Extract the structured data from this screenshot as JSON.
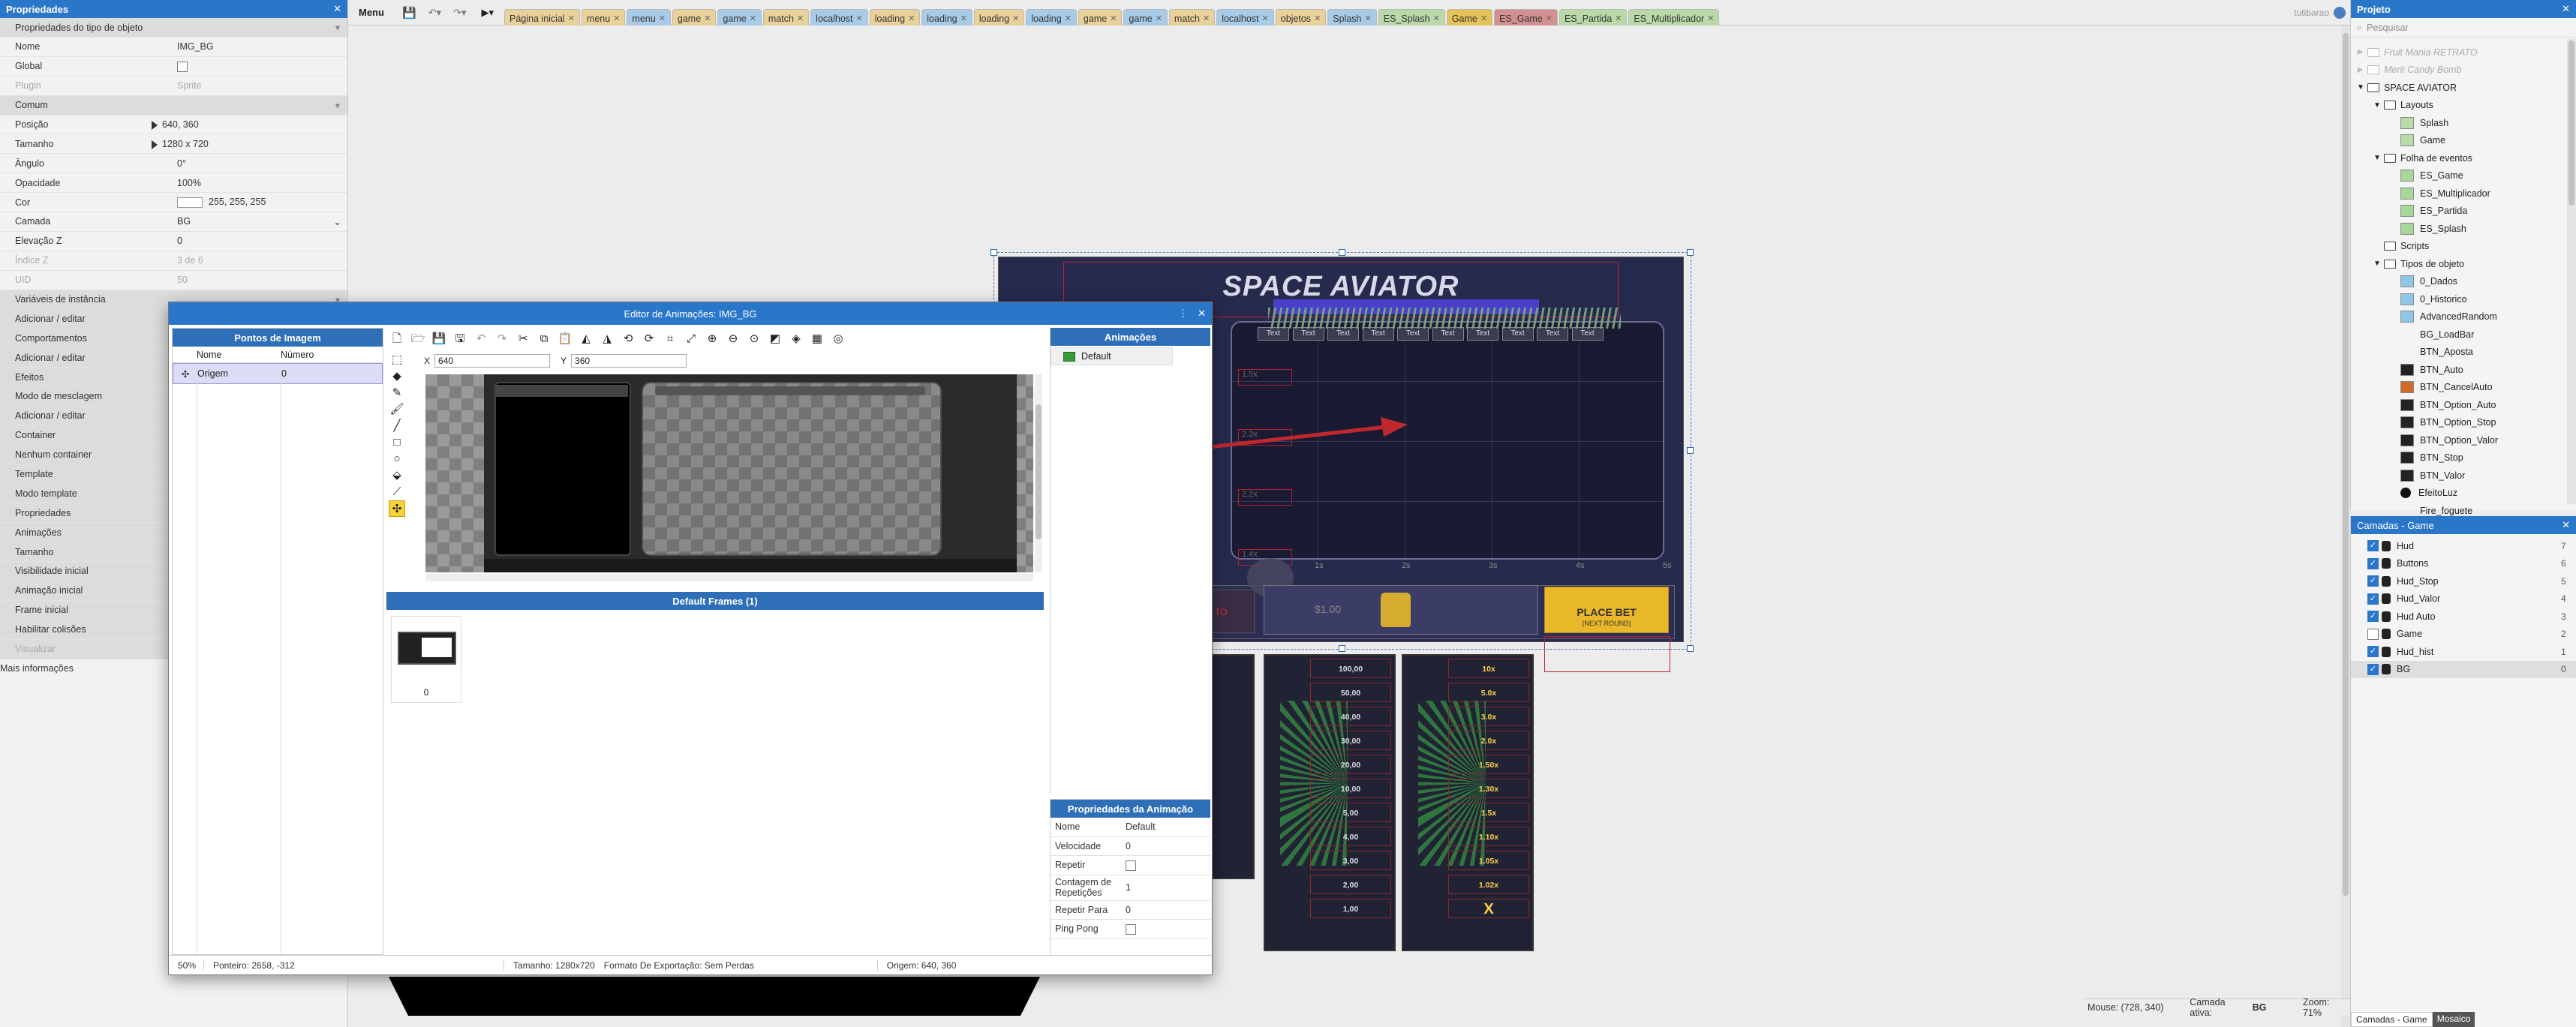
{
  "left_panel": {
    "header": "Propriedades",
    "section_type": "Propriedades do tipo de objeto",
    "rows": [
      {
        "k": "Nome",
        "v": "IMG_BG",
        "style": "row"
      },
      {
        "k": "Global",
        "v": "",
        "style": "check"
      },
      {
        "k": "Plugin",
        "v": "Sprite",
        "style": "dis"
      },
      {
        "k": "Comum",
        "v": "",
        "style": "sec"
      },
      {
        "k": "Posição",
        "v": "640, 360",
        "style": "tri"
      },
      {
        "k": "Tamanho",
        "v": "1280  x 720",
        "style": "tri"
      },
      {
        "k": "Ângulo",
        "v": "0°",
        "style": "row"
      },
      {
        "k": "Opacidade",
        "v": "100%",
        "style": "row"
      },
      {
        "k": "Cor",
        "v": "255, 255, 255",
        "style": "color"
      },
      {
        "k": "Camada",
        "v": "BG",
        "style": "select"
      },
      {
        "k": "Elevação Z",
        "v": "0",
        "style": "row"
      },
      {
        "k": "Índice Z",
        "v": "3 de 6",
        "style": "dis"
      },
      {
        "k": "UID",
        "v": "50",
        "style": "dis"
      },
      {
        "k": "Variáveis de instância",
        "v": "",
        "style": "sec"
      },
      {
        "k": "Adicionar / editar",
        "v": "",
        "style": "link"
      },
      {
        "k": "Comportamentos",
        "v": "",
        "style": "sec"
      },
      {
        "k": "Adicionar / editar",
        "v": "",
        "style": "link"
      },
      {
        "k": "Efeitos",
        "v": "",
        "style": "sec"
      },
      {
        "k": "Modo de mesclagem",
        "v": "",
        "style": "link"
      },
      {
        "k": "Adicionar / editar",
        "v": "",
        "style": "link"
      },
      {
        "k": "Container",
        "v": "",
        "style": "sec"
      },
      {
        "k": "Nenhum container",
        "v": "",
        "style": "link"
      },
      {
        "k": "Template",
        "v": "",
        "style": "sec"
      },
      {
        "k": "Modo template",
        "v": "",
        "style": "link"
      },
      {
        "k": "Propriedades",
        "v": "",
        "style": "sec"
      },
      {
        "k": "Animações",
        "v": "",
        "style": "link"
      },
      {
        "k": "Tamanho",
        "v": "",
        "style": "link"
      },
      {
        "k": "Visibilidade inicial",
        "v": "",
        "style": "link"
      },
      {
        "k": "Animação inicial",
        "v": "",
        "style": "link"
      },
      {
        "k": "Frame inicial",
        "v": "",
        "style": "link"
      },
      {
        "k": "Habilitar colisões",
        "v": "",
        "style": "link"
      },
      {
        "k": "Visualizar",
        "v": "",
        "style": "dislink"
      },
      {
        "k": "Mais informações",
        "v": "",
        "style": "plain"
      }
    ]
  },
  "topbar": {
    "menu_label": "Menu",
    "user": "tutibarao",
    "tabs": [
      {
        "label": "Página inicial",
        "color": "#e9d29a"
      },
      {
        "label": "menu",
        "color": "#e9d29a"
      },
      {
        "label": "menu",
        "color": "#a8cbe8"
      },
      {
        "label": "game",
        "color": "#e9d29a"
      },
      {
        "label": "game",
        "color": "#a8cbe8"
      },
      {
        "label": "match",
        "color": "#e9d29a"
      },
      {
        "label": "localhost",
        "color": "#a8cbe8"
      },
      {
        "label": "loading",
        "color": "#e9d29a"
      },
      {
        "label": "loading",
        "color": "#a8cbe8"
      },
      {
        "label": "loading",
        "color": "#e9d29a"
      },
      {
        "label": "loading",
        "color": "#a8cbe8"
      },
      {
        "label": "game",
        "color": "#e9d29a"
      },
      {
        "label": "game",
        "color": "#a8cbe8"
      },
      {
        "label": "match",
        "color": "#e9d29a"
      },
      {
        "label": "localhost",
        "color": "#a8cbe8"
      },
      {
        "label": "objetos",
        "color": "#e9d29a"
      },
      {
        "label": "Splash",
        "color": "#a8cbe8"
      },
      {
        "label": "ES_Splash",
        "color": "#b9d9a8"
      },
      {
        "label": "Game",
        "color": "#e6c35a"
      },
      {
        "label": "ES_Game",
        "color": "#d49090"
      },
      {
        "label": "ES_Partida",
        "color": "#b9d9a8"
      },
      {
        "label": "ES_Multiplicador",
        "color": "#b9d9a8"
      }
    ]
  },
  "project": {
    "header": "Projeto",
    "search_placeholder": "Pesquisar",
    "items": [
      {
        "label": "Fruit Mania RETRATO",
        "indent": 1,
        "kind": "dim"
      },
      {
        "label": "Merit Candy Bomb",
        "indent": 1,
        "kind": "dim"
      },
      {
        "label": "SPACE AVIATOR",
        "indent": 1,
        "kind": "folder-open"
      },
      {
        "label": "Layouts",
        "indent": 2,
        "kind": "folder-open"
      },
      {
        "label": "Splash",
        "indent": 3,
        "kind": "layout"
      },
      {
        "label": "Game",
        "indent": 3,
        "kind": "layout"
      },
      {
        "label": "Folha de eventos",
        "indent": 2,
        "kind": "folder-open"
      },
      {
        "label": "ES_Game",
        "indent": 3,
        "kind": "event"
      },
      {
        "label": "ES_Multiplicador",
        "indent": 3,
        "kind": "event"
      },
      {
        "label": "ES_Partida",
        "indent": 3,
        "kind": "event"
      },
      {
        "label": "ES_Splash",
        "indent": 3,
        "kind": "event"
      },
      {
        "label": "Scripts",
        "indent": 2,
        "kind": "folder"
      },
      {
        "label": "Tipos de objeto",
        "indent": 2,
        "kind": "folder-open"
      },
      {
        "label": "0_Dados",
        "indent": 3,
        "kind": "grid"
      },
      {
        "label": "0_Historico",
        "indent": 3,
        "kind": "grid"
      },
      {
        "label": "AdvancedRandom",
        "indent": 3,
        "kind": "grid"
      },
      {
        "label": "BG_LoadBar",
        "indent": 3,
        "kind": "none"
      },
      {
        "label": "BTN_Aposta",
        "indent": 3,
        "kind": "none"
      },
      {
        "label": "BTN_Auto",
        "indent": 3,
        "kind": "dark"
      },
      {
        "label": "BTN_CancelAuto",
        "indent": 3,
        "kind": "orange"
      },
      {
        "label": "BTN_Option_Auto",
        "indent": 3,
        "kind": "dark"
      },
      {
        "label": "BTN_Option_Stop",
        "indent": 3,
        "kind": "dark"
      },
      {
        "label": "BTN_Option_Valor",
        "indent": 3,
        "kind": "dark"
      },
      {
        "label": "BTN_Stop",
        "indent": 3,
        "kind": "dark"
      },
      {
        "label": "BTN_Valor",
        "indent": 3,
        "kind": "dark"
      },
      {
        "label": "EfeitoLuz",
        "indent": 3,
        "kind": "dot"
      },
      {
        "label": "Fire_foguete",
        "indent": 3,
        "kind": "none"
      }
    ]
  },
  "layers": {
    "header": "Camadas - Game",
    "items": [
      {
        "label": "Hud",
        "index": "7",
        "checked": true
      },
      {
        "label": "Buttons",
        "index": "6",
        "checked": true
      },
      {
        "label": "Hud_Stop",
        "index": "5",
        "checked": true
      },
      {
        "label": "Hud_Valor",
        "index": "4",
        "checked": true
      },
      {
        "label": "Hud Auto",
        "index": "3",
        "checked": true
      },
      {
        "label": "Game",
        "index": "2",
        "checked": false
      },
      {
        "label": "Hud_hist",
        "index": "1",
        "checked": true
      },
      {
        "label": "BG",
        "index": "0",
        "checked": true
      }
    ],
    "bottom_tabs": [
      "Camadas - Game",
      "Mosaico"
    ]
  },
  "status": {
    "mouse": "Mouse: (728, 340)",
    "active_layer_label": "Camada ativa:",
    "active_layer": "BG",
    "zoom": "Zoom: 71%"
  },
  "game": {
    "title": "SPACE AVIATOR",
    "text_labels": [
      "Text",
      "Text",
      "Text",
      "Text",
      "Text",
      "Text",
      "Text",
      "Text",
      "Text",
      "Text"
    ],
    "left_axis": [
      "1.5x",
      "2.3x",
      "2.2x",
      "1.4x"
    ],
    "bottom_axis": [
      "1s",
      "2s",
      "3s",
      "4s",
      "5s"
    ],
    "amount": "$1.00",
    "auto_label": "TO",
    "place_bet": "PLACE BET",
    "next_round": "(NEXT ROUND)",
    "card1": [
      "100,00",
      "50,00",
      "40,00",
      "30,00",
      "20,00",
      "10,00",
      "5,00",
      "4,00",
      "3,00",
      "2,00",
      "1,00"
    ],
    "card2": [
      "10x",
      "5.0x",
      "3.0x",
      "2.0x",
      "1.50x",
      "1.30x",
      "1.5x",
      "1.10x",
      "1.05x",
      "1.02x",
      "X"
    ]
  },
  "editor": {
    "title": "Editor de Animações: IMG_BG",
    "image_points_header": "Pontos de Imagem",
    "col_name": "Nome",
    "col_number": "Número",
    "point_name": "Origem",
    "point_number": "0",
    "x_label": "X",
    "x_value": "640",
    "y_label": "Y",
    "y_value": "360",
    "frames_header": "Default Frames (1)",
    "frame_index": "0",
    "animations_header": "Animações",
    "animation_name": "Default",
    "anim_props_header": "Propriedades da Animação",
    "props": [
      {
        "k": "Nome",
        "v": "Default",
        "type": "text"
      },
      {
        "k": "Velocidade",
        "v": "0",
        "type": "text"
      },
      {
        "k": "Repetir",
        "v": "",
        "type": "check"
      },
      {
        "k": "Contagem de Repetições",
        "v": "1",
        "type": "text"
      },
      {
        "k": "Repetir Para",
        "v": "0",
        "type": "text"
      },
      {
        "k": "Ping Pong",
        "v": "",
        "type": "check"
      }
    ],
    "status_zoom": "50%",
    "status_pointer": "Ponteiro: 2658, -312",
    "status_size": "Tamanho: 1280x720",
    "status_export": "Formato De Exportação: Sem Perdas",
    "status_origin": "Origem: 640, 360"
  },
  "colors": {
    "accent_blue": "#2a77c9",
    "game_bg": "#262b4e",
    "viewport_bg": "#1b1a33",
    "place_bet_gold": "#e8b82a",
    "arrow_red": "#c0282f"
  }
}
